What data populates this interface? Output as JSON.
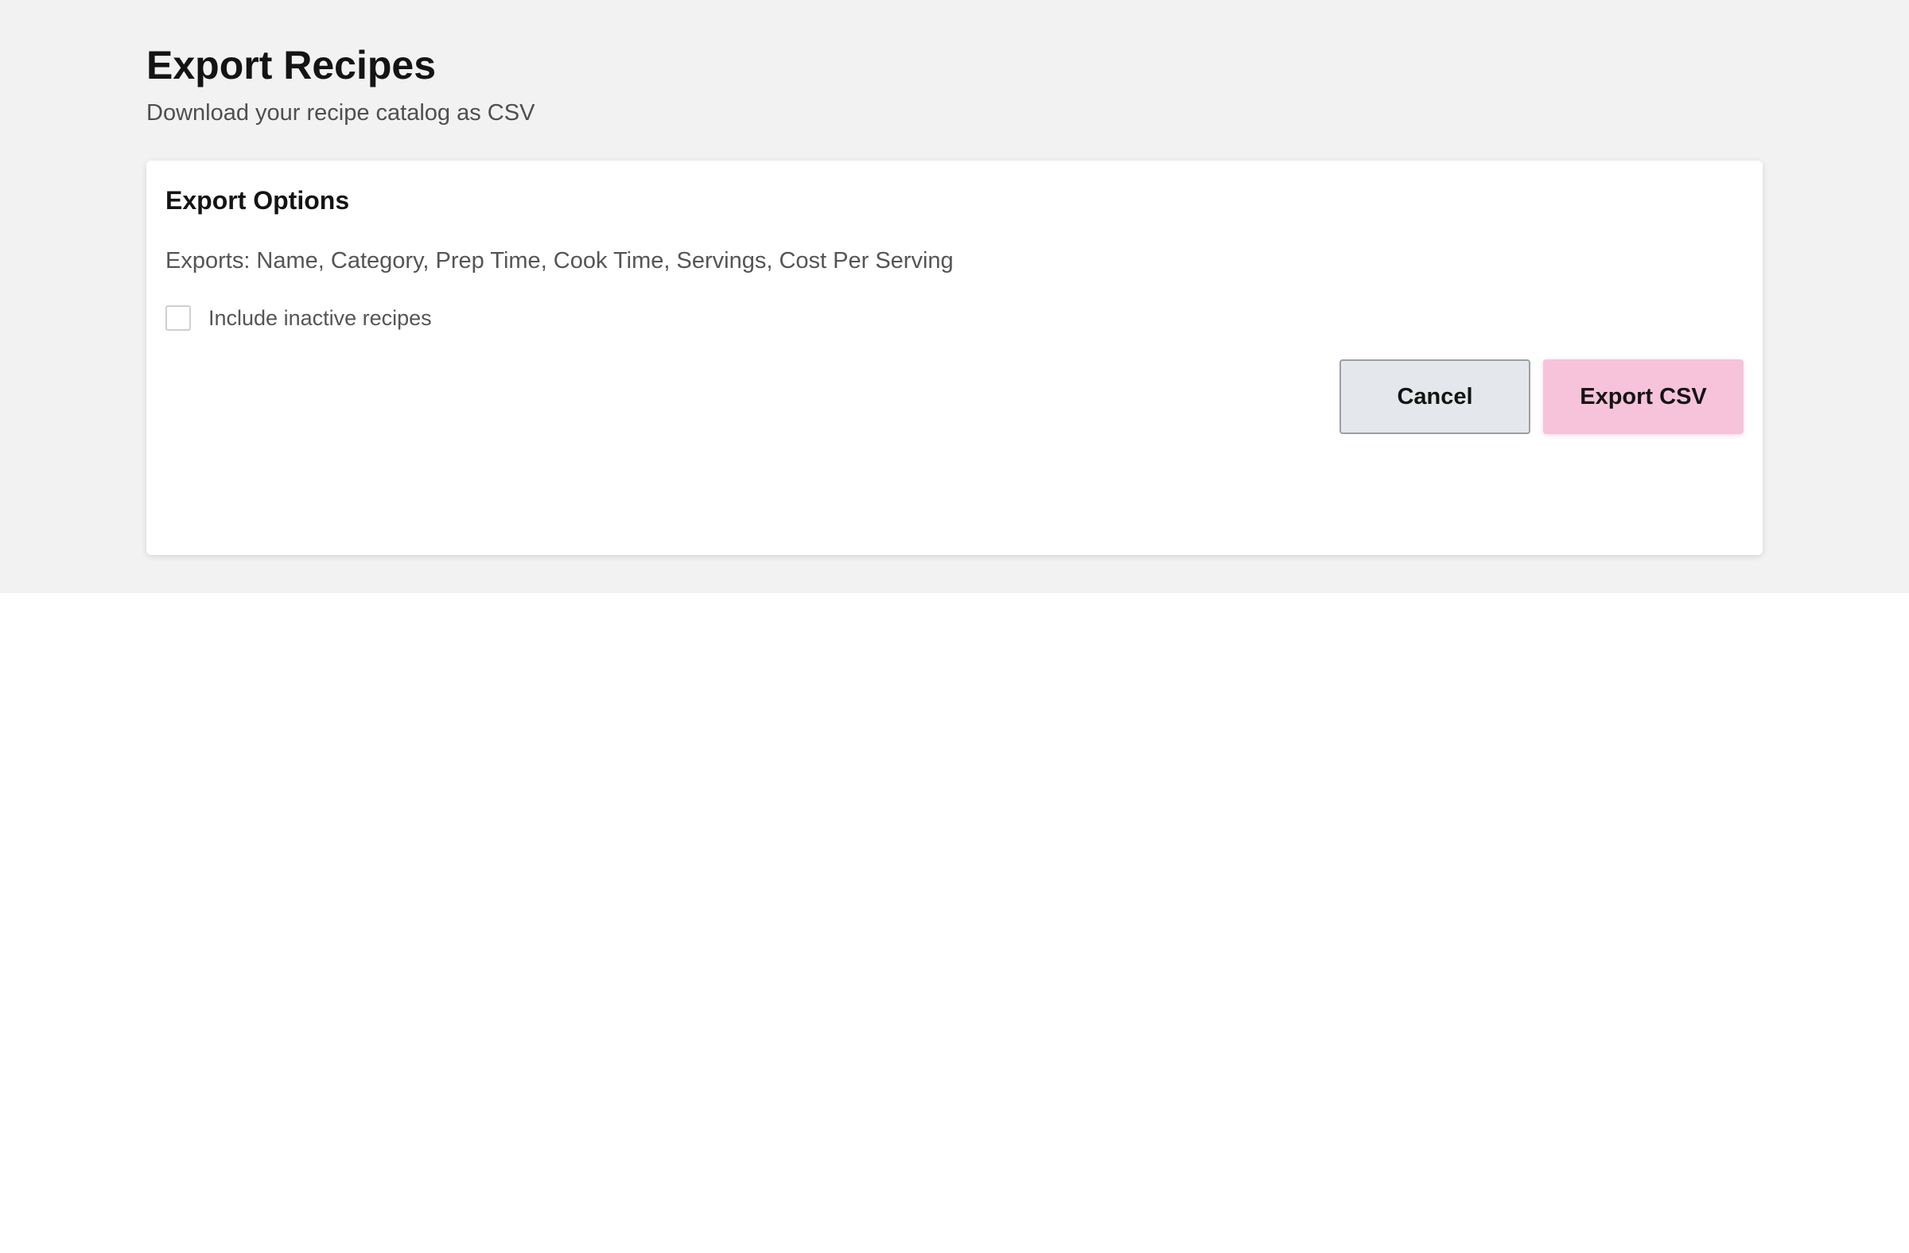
{
  "header": {
    "title": "Export Recipes",
    "subtitle": "Download your recipe catalog as CSV"
  },
  "card": {
    "title": "Export Options",
    "fields_text": "Exports: Name, Category, Prep Time, Cook Time, Servings, Cost Per Serving",
    "include_inactive": {
      "label": "Include inactive recipes",
      "checked": false
    },
    "actions": {
      "cancel_label": "Cancel",
      "export_label": "Export CSV"
    }
  },
  "colors": {
    "page_background": "#f2f2f2",
    "card_background": "#ffffff",
    "cancel_button": "#e4e7eb",
    "export_button": "#f7c3da"
  }
}
